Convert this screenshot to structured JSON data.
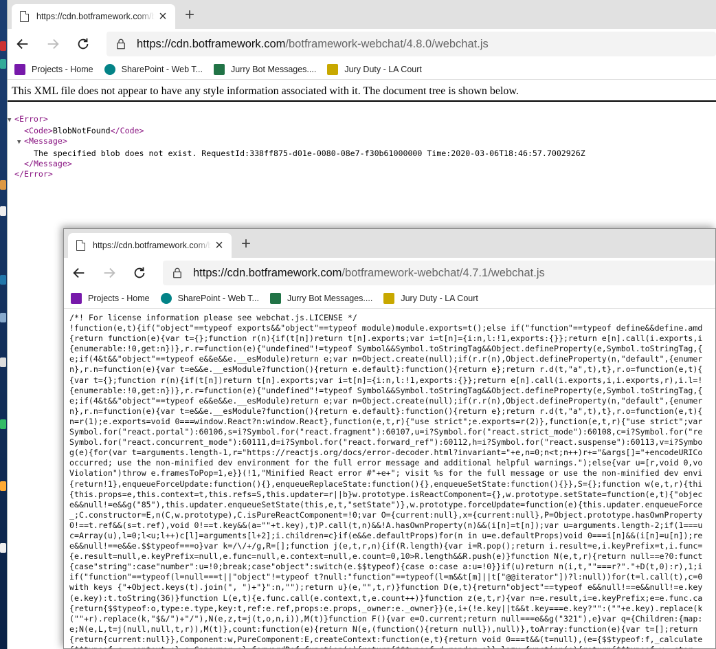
{
  "window_back": {
    "tab_title": "https://cdn.botframework.com/b",
    "url_host": "https://cdn.botframework.com",
    "url_path": "/botframework-webchat/4.8.0/webchat.js",
    "xml_notice": "This XML file does not appear to have any style information associated with it. The document tree is shown below.",
    "xml": {
      "error_open": "<Error>",
      "code_open": "<Code>",
      "code_value": "BlobNotFound",
      "code_close": "</Code>",
      "message_open": "<Message>",
      "message_text": "The specified blob does not exist. RequestId:338ff875-d01e-0080-08e7-f30b61000000 Time:2020-03-06T18:46:57.7002926Z",
      "message_close": "</Message>",
      "error_close": "</Error>"
    }
  },
  "window_front": {
    "tab_title": "https://cdn.botframework.com/b",
    "url_host": "https://cdn.botframework.com",
    "url_path": "/botframework-webchat/4.7.1/webchat.js",
    "code_lines": [
      "/*! For license information please see webchat.js.LICENSE */",
      "!function(e,t){if(\"object\"==typeof exports&&\"object\"==typeof module)module.exports=t();else if(\"function\"==typeof define&&define.amd",
      "{return function(e){var t={};function r(n){if(t[n])return t[n].exports;var i=t[n]={i:n,l:!1,exports:{}};return e[n].call(i.exports,i",
      "{enumerable:!0,get:n})},r.r=function(e){\"undefined\"!=typeof Symbol&&Symbol.toStringTag&&Object.defineProperty(e,Symbol.toStringTag,{",
      "e;if(4&t&&\"object\"==typeof e&&e&&e.__esModule)return e;var n=Object.create(null);if(r.r(n),Object.defineProperty(n,\"default\",{enumer",
      "n},r.n=function(e){var t=e&&e.__esModule?function(){return e.default}:function(){return e};return r.d(t,\"a\",t),t},r.o=function(e,t){",
      "{var t={};function r(n){if(t[n])return t[n].exports;var i=t[n]={i:n,l:!1,exports:{}};return e[n].call(i.exports,i,i.exports,r),i.l=!",
      "{enumerable:!0,get:n})},r.r=function(e){\"undefined\"!=typeof Symbol&&Symbol.toStringTag&&Object.defineProperty(e,Symbol.toStringTag,{",
      "e;if(4&t&&\"object\"==typeof e&&e&&e.__esModule)return e;var n=Object.create(null);if(r.r(n),Object.defineProperty(n,\"default\",{enumer",
      "n},r.n=function(e){var t=e&&e.__esModule?function(){return e.default}:function(){return e};return r.d(t,\"a\",t),t},r.o=function(e,t){",
      "n=r(1);e.exports=void 0===window.React?n:window.React},function(e,t,r){\"use strict\";e.exports=r(2)},function(e,t,r){\"use strict\";var",
      "Symbol.for(\"react.portal\"):60106,s=i?Symbol.for(\"react.fragment\"):60107,u=i?Symbol.for(\"react.strict_mode\"):60108,c=i?Symbol.for(\"re",
      "Symbol.for(\"react.concurrent_mode\"):60111,d=i?Symbol.for(\"react.forward_ref\"):60112,h=i?Symbol.for(\"react.suspense\"):60113,v=i?Symbo",
      "g(e){for(var t=arguments.length-1,r=\"https://reactjs.org/docs/error-decoder.html?invariant=\"+e,n=0;n<t;n++)r+=\"&args[]=\"+encodeURICo",
      "occurred; use the non-minified dev environment for the full error message and additional helpful warnings.\");else{var u=[r,void 0,vo",
      "Violation\")throw e.framesToPop=1,e}}(!1,\"Minified React error #\"+e+\"; visit %s for the full message or use the non-minified dev envi",
      "{return!1},enqueueForceUpdate:function(){},enqueueReplaceState:function(){},enqueueSetState:function(){}},S={};function w(e,t,r){thi",
      "{this.props=e,this.context=t,this.refs=S,this.updater=r||b}w.prototype.isReactComponent={},w.prototype.setState=function(e,t){\"objec",
      "e&&null!=e&&g(\"85\"),this.updater.enqueueSetState(this,e,t,\"setState\")},w.prototype.forceUpdate=function(e){this.updater.enqueueForce",
      "_;C.constructor=E,n(C,w.prototype),C.isPureReactComponent=!0;var O={current:null},x={current:null},P=Object.prototype.hasOwnProperty",
      "0!==t.ref&&(s=t.ref),void 0!==t.key&&(a=\"\"+t.key),t)P.call(t,n)&&!A.hasOwnProperty(n)&&(i[n]=t[n]);var u=arguments.length-2;if(1===u",
      "c=Array(u),l=0;l<u;l++)c[l]=arguments[l+2];i.children=c}if(e&&e.defaultProps)for(n in u=e.defaultProps)void 0===i[n]&&(i[n]=u[n]);re",
      "e&&null!==e&&e.$$typeof===o}var k=/\\/+/g,R=[];function j(e,t,r,n){if(R.length){var i=R.pop();return i.result=e,i.keyPrefix=t,i.func=",
      "{e.result=null,e.keyPrefix=null,e.func=null,e.context=null,e.count=0,10>R.length&&R.push(e)}function N(e,t,r){return null==e?0:funct",
      "{case\"string\":case\"number\":u=!0;break;case\"object\":switch(e.$$typeof){case o:case a:u=!0}}if(u)return n(i,t,\"\"===r?\".\"+D(t,0):r),1;i",
      "if(\"function\"==typeof(l=null===t||\"object\"!=typeof t?null:\"function\"==typeof(l=m&&t[m]||t[\"@@iterator\"])?l:null))for(t=l.call(t),c=0",
      "with keys {\"+Object.keys(t).join(\", \")+\"}\":n,\"\");return u}(e,\"\",t,r)}function D(e,t){return\"object\"==typeof e&&null!==e&&null!=e.key",
      "(e.key):t.toString(36)}function L(e,t){e.func.call(e.context,t,e.count++)}function z(e,t,r){var n=e.result,i=e.keyPrefix;e=e.func.ca",
      "{return{$$typeof:o,type:e.type,key:t,ref:e.ref,props:e.props,_owner:e._owner}}(e,i+(!e.key||t&&t.key===e.key?\"\":(\"\"+e.key).replace(k",
      "(\"\"+r).replace(k,\"$&/\")+\"/\"),N(e,z,t=j(t,o,n,i)),M(t)}function F(){var e=O.current;return null===e&&g(\"321\"),e}var q={Children:{map:",
      "e;N(e,L,t=j(null,null,t,r)),M(t)},count:function(e){return N(e,(function(){return null}),null)},toArray:function(e){var t=[];return",
      "{return{current:null}},Component:w,PureComponent:E,createContext:function(e,t){return void 0===t&&(t=null),(e={$$typeof:f,_calculate",
      "{$$typeof:c,_context:e},e.Consumer=e},forwardRef:function(e){return{$$typeof:d,render:e}},lazy:function(e){return{$$typeof:v,_ctor"
    ]
  },
  "favorites": [
    {
      "label": "Projects - Home",
      "icon": "onenote-icon",
      "color": "#7719aa"
    },
    {
      "label": "SharePoint - Web T...",
      "icon": "sharepoint-icon",
      "color": "#038387"
    },
    {
      "label": "Jurry Bot Messages....",
      "icon": "excel-icon",
      "color": "#217346"
    },
    {
      "label": "Jury Duty - LA Court",
      "icon": "courthouse-icon",
      "color": "#c8a800"
    }
  ]
}
